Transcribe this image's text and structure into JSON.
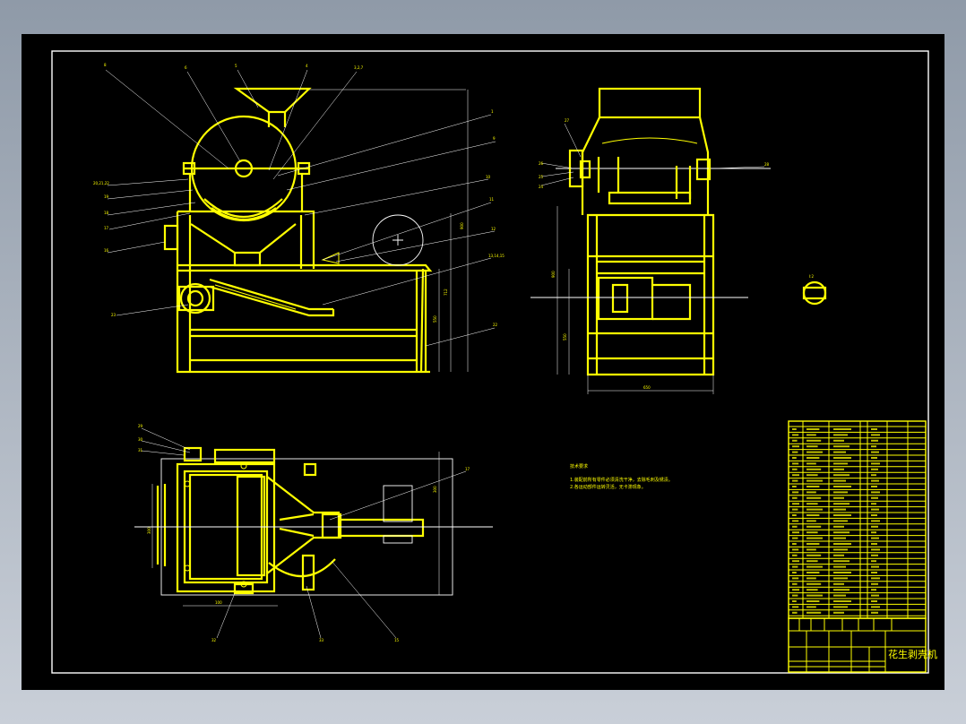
{
  "drawing": {
    "title_block": {
      "machine_name": "花生剥壳机"
    },
    "technical_requirements": {
      "heading": "技术要求",
      "lines": [
        "1.装配前所有零件必须清洗干净，去除毛刺及锈渍。",
        "2.各运动部件运转灵活，无卡滞现象。"
      ]
    },
    "colors": {
      "background_frame": "#8f9aa8",
      "drawing_area": "#000000",
      "geometry": "#ffff00",
      "dimension_lines": "#ffffff"
    }
  }
}
